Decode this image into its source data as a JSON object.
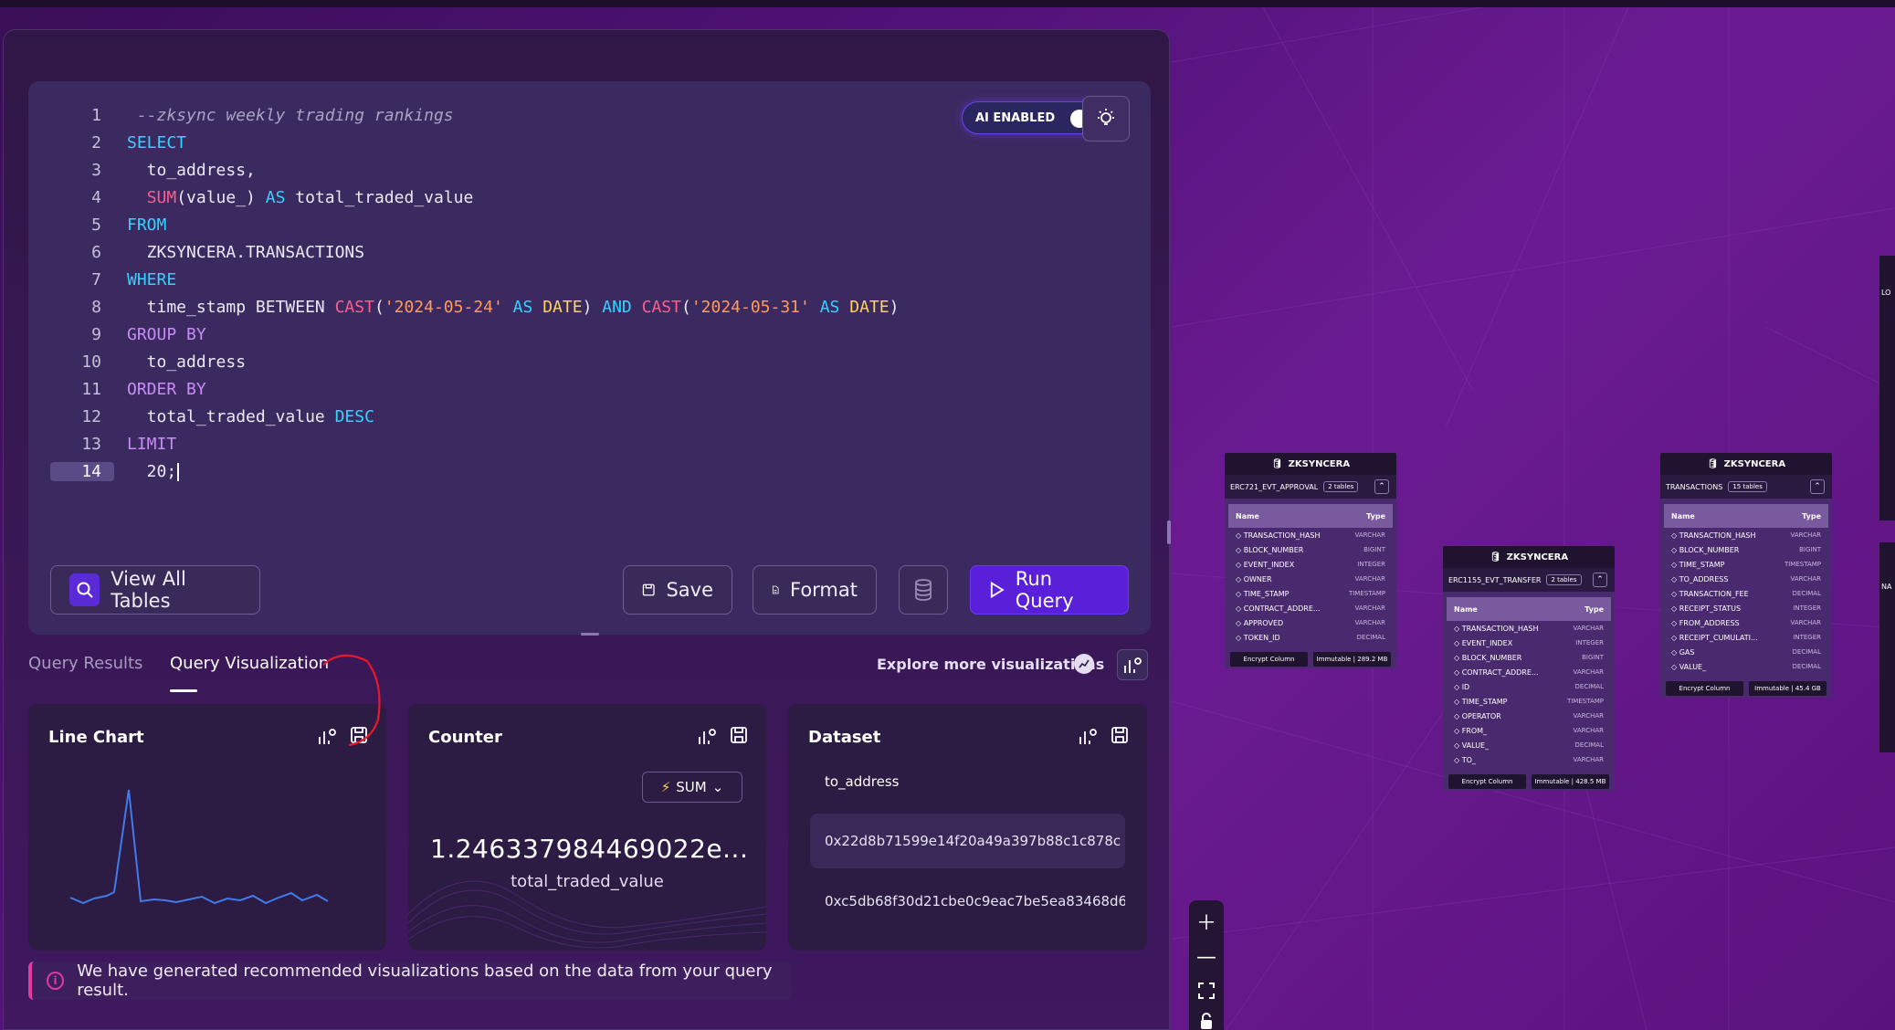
{
  "editor": {
    "lines": [
      {
        "n": "1",
        "html": "<span class=\"cm\"> --zksync weekly trading rankings</span>"
      },
      {
        "n": "2",
        "html": "<span class=\"kw\">SELECT</span>"
      },
      {
        "n": "3",
        "html": "  to_address,"
      },
      {
        "n": "4",
        "html": "  <span class=\"fn\">SUM</span>(value_) <span class=\"kw\">AS</span> total_traded_value"
      },
      {
        "n": "5",
        "html": "<span class=\"kw\">FROM</span>"
      },
      {
        "n": "6",
        "html": "  ZKSYNCERA.TRANSACTIONS"
      },
      {
        "n": "7",
        "html": "<span class=\"kw\">WHERE</span>"
      },
      {
        "n": "8",
        "html": "  time_stamp BETWEEN <span class=\"fn\">CAST</span>(<span class=\"str\">'2024-05-24'</span> <span class=\"kw\">AS</span> <span class=\"ty\">DATE</span>) <span class=\"kw\">AND</span> <span class=\"fn\">CAST</span>(<span class=\"str\">'2024-05-31'</span> <span class=\"kw\">AS</span> <span class=\"ty\">DATE</span>)"
      },
      {
        "n": "9",
        "html": "<span class=\"kw2\">GROUP BY</span>"
      },
      {
        "n": "10",
        "html": "  to_address"
      },
      {
        "n": "11",
        "html": "<span class=\"kw2\">ORDER BY</span>"
      },
      {
        "n": "12",
        "html": "  total_traded_value <span class=\"kw\">DESC</span>"
      },
      {
        "n": "13",
        "html": "<span class=\"kw2\">LIMIT</span>"
      },
      {
        "n": "14",
        "html": "  20;"
      }
    ],
    "ai_label": "AI ENABLED",
    "buttons": {
      "view_all": "View All Tables",
      "save": "Save",
      "format": "Format",
      "run": "Run Query"
    }
  },
  "tabs": [
    {
      "label": "Query Results"
    },
    {
      "label": "Query Visualization"
    }
  ],
  "explore_label": "Explore more visualizations",
  "cards": {
    "line": {
      "title": "Line Chart"
    },
    "counter": {
      "title": "Counter",
      "agg": "SUM",
      "value": "1.246337984469022e...",
      "label": "total_traded_value"
    },
    "dataset": {
      "title": "Dataset",
      "column": "to_address",
      "rows": [
        "0x22d8b71599e14f20a49a397b88c1c878c",
        "0xc5db68f30d21cbe0c9eac7be5ea83468d6"
      ]
    }
  },
  "info": "We have generated recommended visualizations based on the data from your query result.",
  "db_widgets": [
    {
      "schema": "ZKSYNCERA",
      "table": "ERC721_EVT_APPROVAL",
      "count": "2 tables",
      "header_name": "Name",
      "header_type": "Type",
      "rows": [
        [
          "TRANSACTION_HASH",
          "VARCHAR"
        ],
        [
          "BLOCK_NUMBER",
          "BIGINT"
        ],
        [
          "EVENT_INDEX",
          "INTEGER"
        ],
        [
          "OWNER",
          "VARCHAR"
        ],
        [
          "TIME_STAMP",
          "TIMESTAMP"
        ],
        [
          "CONTRACT_ADDRE...",
          "VARCHAR"
        ],
        [
          "APPROVED",
          "VARCHAR"
        ],
        [
          "TOKEN_ID",
          "DECIMAL"
        ]
      ],
      "footer_left": "Encrypt Column",
      "footer_right": "Immutable | 289.2 MB"
    },
    {
      "schema": "ZKSYNCERA",
      "table": "ERC1155_EVT_TRANSFER",
      "count": "2 tables",
      "header_name": "Name",
      "header_type": "Type",
      "rows": [
        [
          "TRANSACTION_HASH",
          "VARCHAR"
        ],
        [
          "EVENT_INDEX",
          "INTEGER"
        ],
        [
          "BLOCK_NUMBER",
          "BIGINT"
        ],
        [
          "CONTRACT_ADDRE...",
          "VARCHAR"
        ],
        [
          "ID",
          "DECIMAL"
        ],
        [
          "TIME_STAMP",
          "TIMESTAMP"
        ],
        [
          "OPERATOR",
          "VARCHAR"
        ],
        [
          "FROM_",
          "VARCHAR"
        ],
        [
          "VALUE_",
          "DECIMAL"
        ],
        [
          "TO_",
          "VARCHAR"
        ]
      ],
      "footer_left": "Encrypt Column",
      "footer_right": "Immutable | 428.5 MB"
    },
    {
      "schema": "ZKSYNCERA",
      "table": "TRANSACTIONS",
      "count": "15 tables",
      "header_name": "Name",
      "header_type": "Type",
      "rows": [
        [
          "TRANSACTION_HASH",
          "VARCHAR"
        ],
        [
          "BLOCK_NUMBER",
          "BIGINT"
        ],
        [
          "TIME_STAMP",
          "TIMESTAMP"
        ],
        [
          "TO_ADDRESS",
          "VARCHAR"
        ],
        [
          "TRANSACTION_FEE",
          "DECIMAL"
        ],
        [
          "RECEIPT_STATUS",
          "INTEGER"
        ],
        [
          "FROM_ADDRESS",
          "VARCHAR"
        ],
        [
          "RECEIPT_CUMULATI...",
          "INTEGER"
        ],
        [
          "GAS",
          "DECIMAL"
        ],
        [
          "VALUE_",
          "DECIMAL"
        ]
      ],
      "footer_left": "Encrypt Column",
      "footer_right": "Immutable | 45.4 GB"
    }
  ],
  "edge_widget_labels": [
    "LO",
    "NA"
  ],
  "colors": {
    "accent": "#5a1fd9",
    "info_border": "#e23b9e",
    "line_series": "#3f7bea"
  }
}
